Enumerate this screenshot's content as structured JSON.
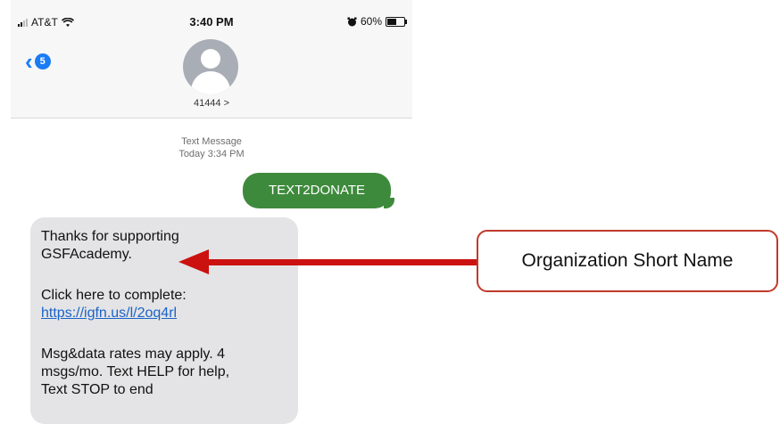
{
  "status_bar": {
    "carrier": "AT&T",
    "time": "3:40 PM",
    "battery_percent_label": "60%",
    "battery_level": 0.6,
    "icons": [
      "signal-icon",
      "wifi-icon",
      "alarm-icon",
      "battery-icon"
    ]
  },
  "header": {
    "back_badge": "5",
    "contact_name": "41444 >"
  },
  "thread_meta": {
    "channel": "Text Message",
    "timestamp": "Today 3:34 PM"
  },
  "messages": {
    "sent_text": "TEXT2DONATE",
    "received": {
      "line1": "Thanks for supporting",
      "line2": "GSFAcademy.",
      "line3": "Click here to complete:",
      "link": "https://igfn.us/l/2oq4rl",
      "line5": "Msg&data rates may apply. 4",
      "line6": "msgs/mo. Text HELP for help,",
      "line7": "Text STOP to end"
    }
  },
  "annotation": {
    "label": "Organization Short Name",
    "arrow_color": "#cc1111"
  },
  "colors": {
    "sent_bubble": "#3e8a3c",
    "received_bubble": "#e4e4e6",
    "accent": "#1a7cf5",
    "link": "#1a63c7"
  }
}
